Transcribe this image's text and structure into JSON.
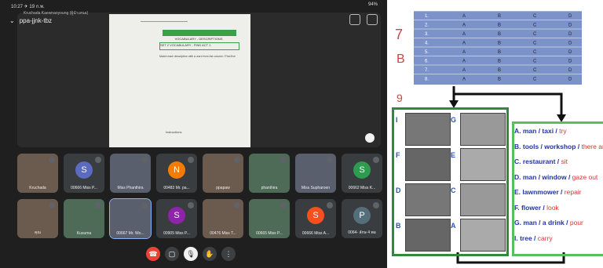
{
  "status": {
    "time": "10:27 ✈ 19 ก.พ.",
    "battery": "94%"
  },
  "meeting": {
    "code": "ppa-jjnk-tbz",
    "subtitle": "Kruchada Kaewnaoyoung (ผู้นำเสนอ)"
  },
  "slide": {
    "title": "VOCABULARY - DESCRIPTIONS",
    "set": "SET 2   VOCABULARY - FIND ACT 1",
    "instruction": "Match each description with a word from the column / Find five",
    "note": "Instructions"
  },
  "participants": [
    {
      "name": "Kruchada",
      "type": "photo"
    },
    {
      "name": "00666 Miss P...",
      "initial": "S",
      "color": "#5c6bc0"
    },
    {
      "name": "Miss Phanthira",
      "type": "photo"
    },
    {
      "name": "00483 Mr. pa...",
      "initial": "N",
      "color": "#f57c00"
    },
    {
      "name": "ppapaw",
      "type": "photo"
    },
    {
      "name": "phanthira",
      "type": "photo"
    },
    {
      "name": "Miss Supharoen",
      "type": "photo"
    },
    {
      "name": "00662 Miss K...",
      "initial": "S",
      "color": "#2e9c4f"
    },
    {
      "name": "คุณ",
      "type": "photo"
    },
    {
      "name": "Kusuma",
      "type": "photo"
    },
    {
      "name": "00667 Mr. Wo...",
      "type": "photo"
    },
    {
      "name": "00905 Miss P...",
      "initial": "S",
      "color": "#8e24aa"
    },
    {
      "name": "00476 Miss T...",
      "type": "photo"
    },
    {
      "name": "00665 Miss P...",
      "type": "photo"
    },
    {
      "name": "00666 Miss A...",
      "initial": "S",
      "color": "#f4511e"
    },
    {
      "name": "0064- ลักษ 4 พอ",
      "initial": "P",
      "color": "#546e7a"
    }
  ],
  "answer_sheet": {
    "rows": [
      "1.",
      "2.",
      "3.",
      "4.",
      "5.",
      "6.",
      "7.",
      "8."
    ],
    "choices": [
      "A",
      "B",
      "C",
      "D"
    ]
  },
  "worksheet": {
    "picture_labels": [
      "I",
      "G",
      "F",
      "E",
      "D",
      "C",
      "B",
      "A"
    ],
    "phrases": [
      {
        "label": "A.",
        "text": "man / taxi /",
        "extra": "try"
      },
      {
        "label": "B.",
        "text": "tools / workshop /",
        "extra": "there are"
      },
      {
        "label": "C.",
        "text": "restaurant /",
        "extra": "sit"
      },
      {
        "label": "D.",
        "text": "man / window /",
        "extra": "gaze out"
      },
      {
        "label": "E.",
        "text": "lawnmower /",
        "extra": "repair"
      },
      {
        "label": "F.",
        "text": "flower /",
        "extra": "look"
      },
      {
        "label": "G.",
        "text": "man / a drink /",
        "extra": "pour"
      },
      {
        "label": "I.",
        "text": "tree /",
        "extra": "carry"
      }
    ]
  },
  "colors": {
    "end_call": "#ea4335",
    "green_frame": "#2f8a3e",
    "table_blue": "#7b93c9"
  }
}
